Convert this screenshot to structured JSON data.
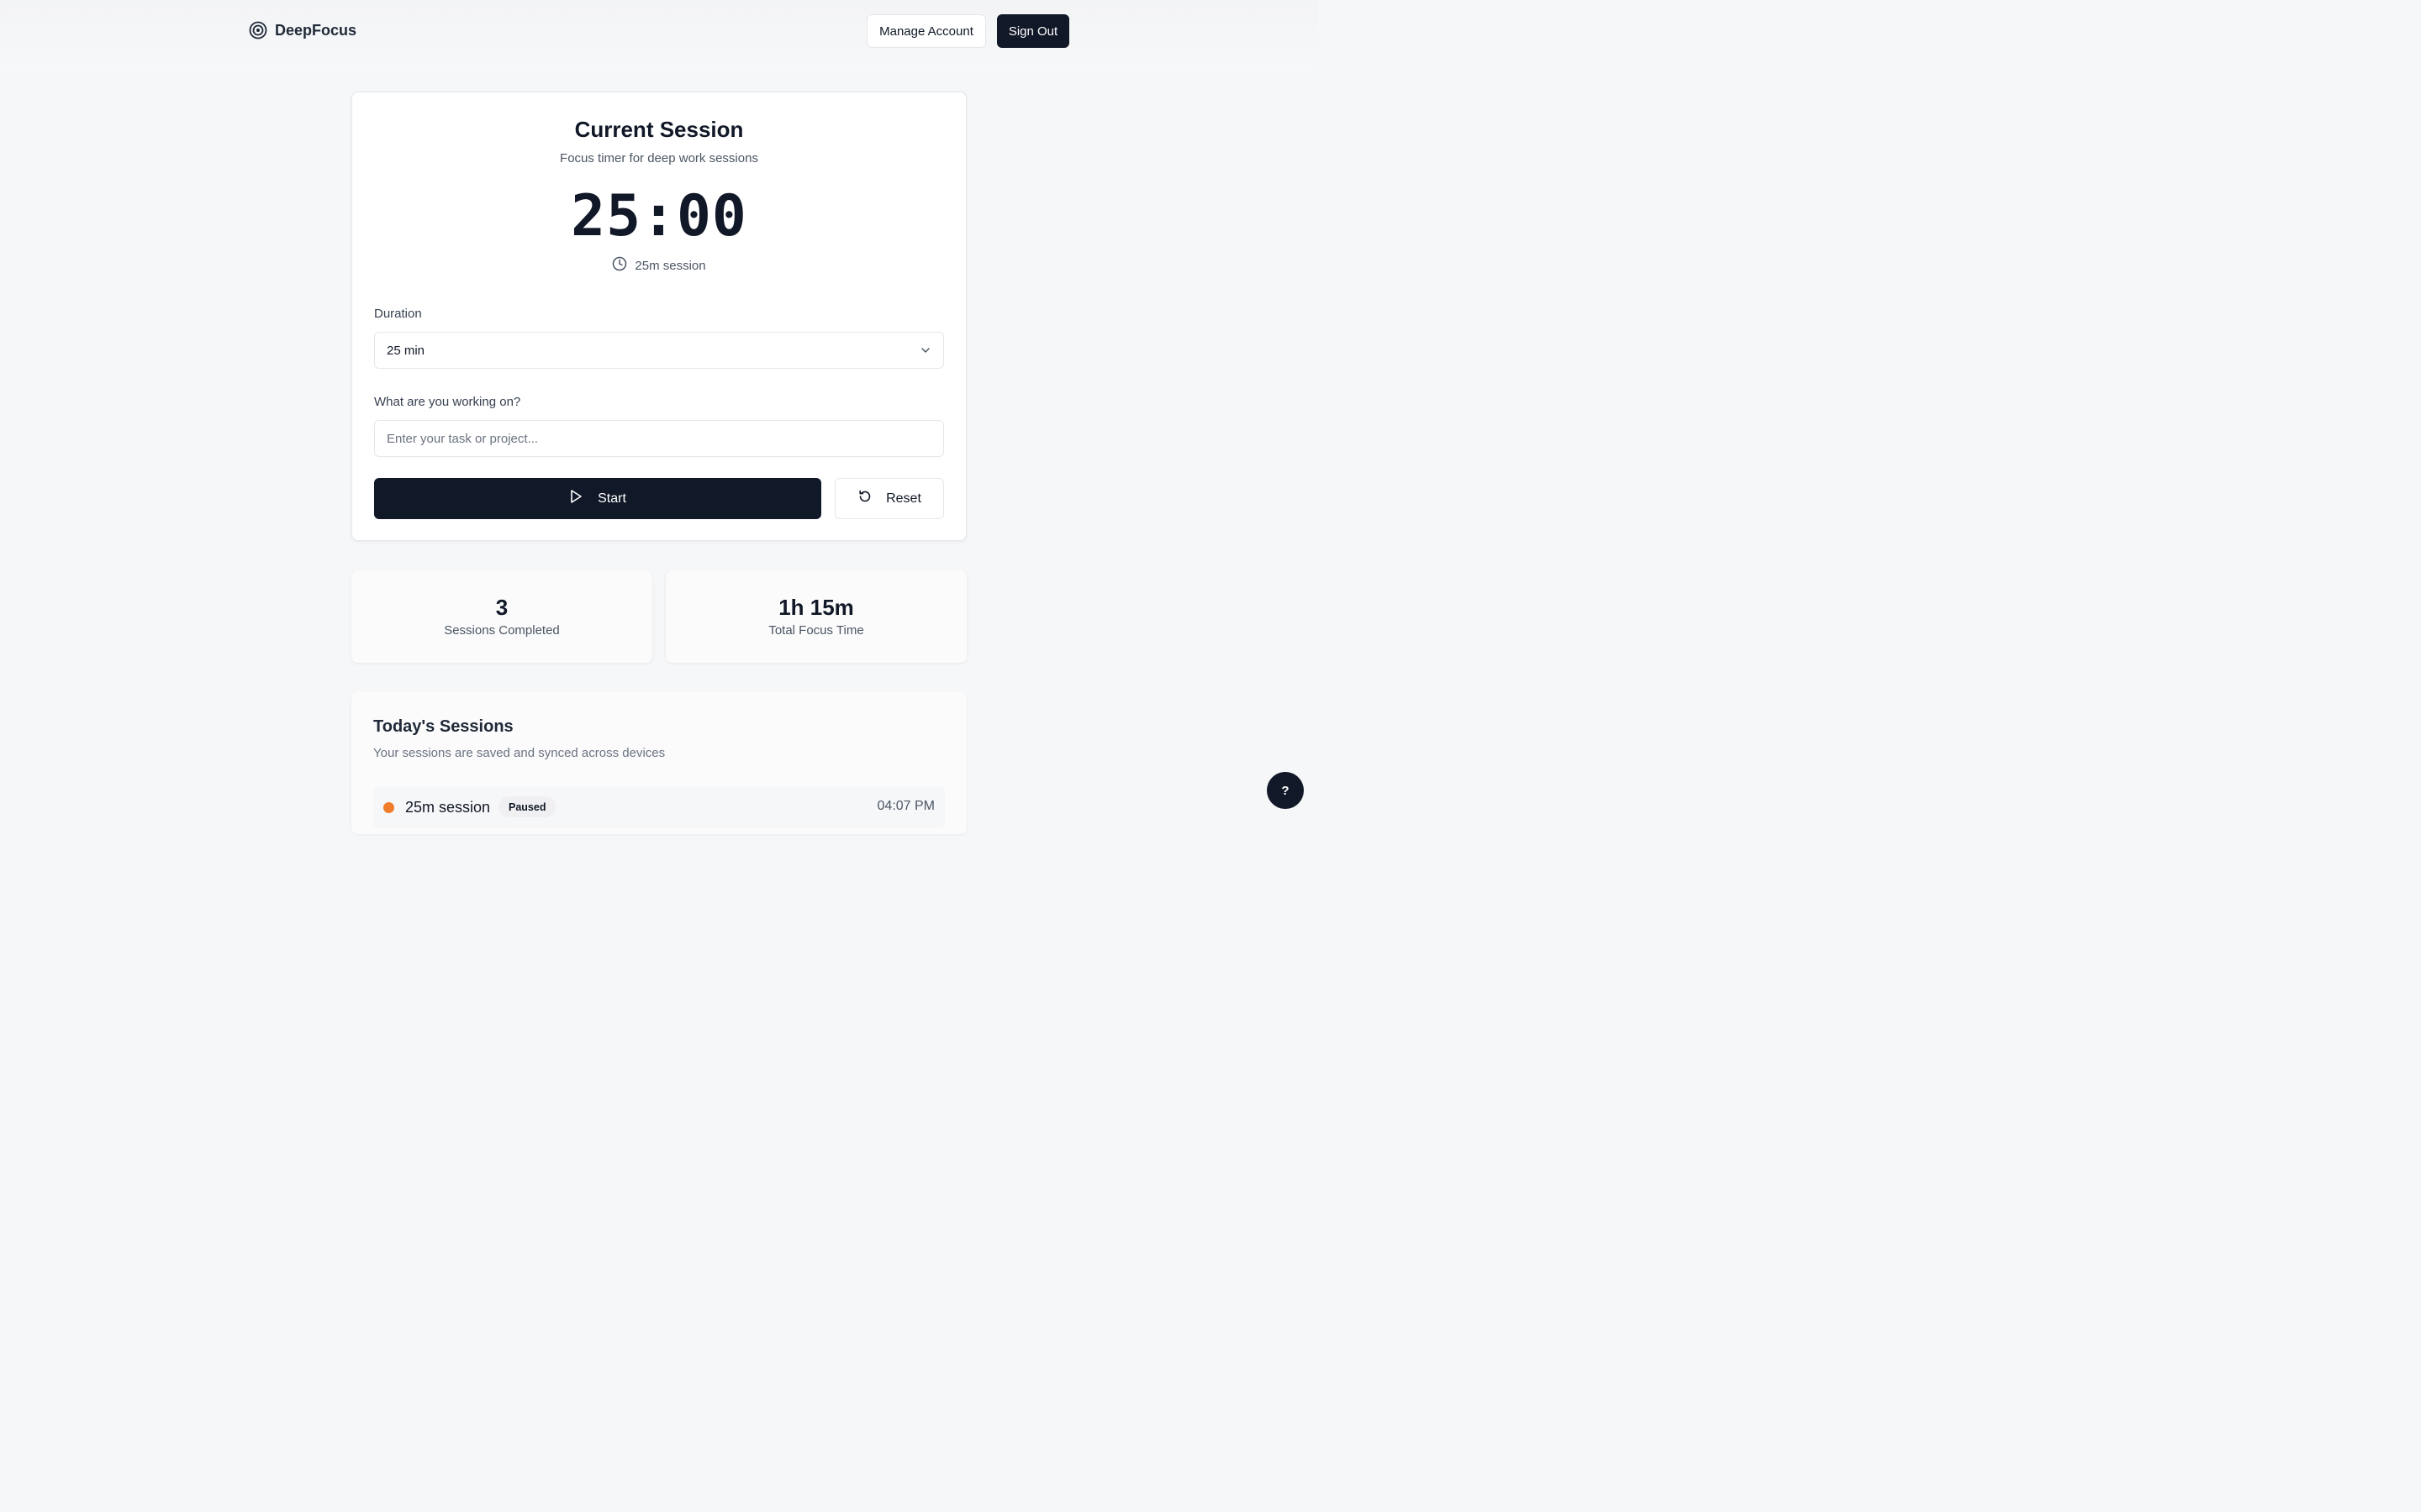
{
  "header": {
    "brand": "DeepFocus",
    "brand_icon": "target-icon",
    "manage_account": "Manage Account",
    "sign_out": "Sign Out"
  },
  "session": {
    "title": "Current Session",
    "subtitle": "Focus timer for deep work sessions",
    "timer": "25:00",
    "timer_meta": "25m session",
    "duration_label": "Duration",
    "duration_value": "25 min",
    "task_label": "What are you working on?",
    "task_placeholder": "Enter your task or project...",
    "task_value": "",
    "start": "Start",
    "reset": "Reset"
  },
  "stats": [
    {
      "value": "3",
      "label": "Sessions Completed"
    },
    {
      "value": "1h 15m",
      "label": "Total Focus Time"
    }
  ],
  "history": {
    "title": "Today's Sessions",
    "subtitle": "Your sessions are saved and synced across devices",
    "sessions": [
      {
        "name": "25m session",
        "status": "Paused",
        "time": "04:07 PM",
        "status_color": "#f07d2b"
      }
    ]
  },
  "help": "?",
  "colors": {
    "primary": "#111827",
    "paused": "#f07d2b",
    "background": "#f6f7f9"
  }
}
